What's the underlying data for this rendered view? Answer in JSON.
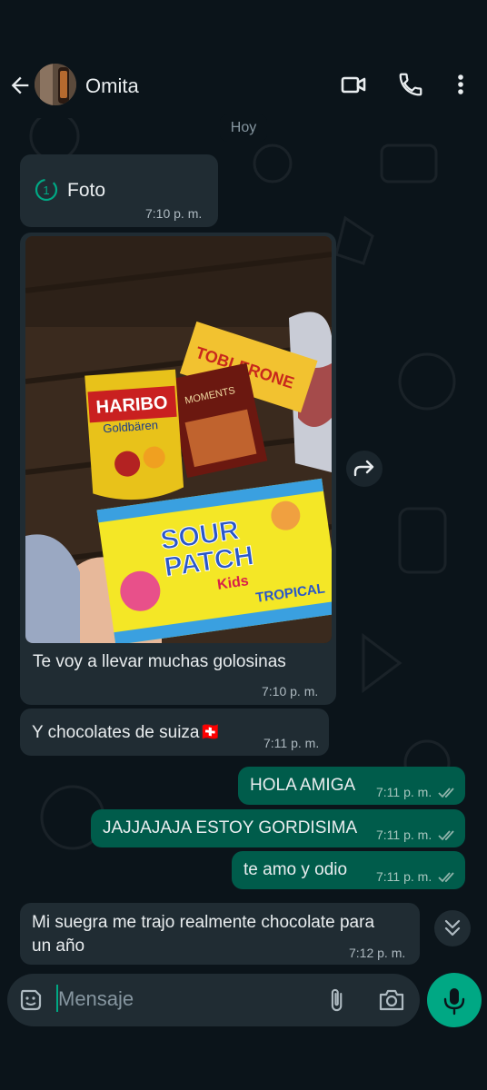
{
  "header": {
    "contact_name": "Omita"
  },
  "date_chip": "Hoy",
  "messages": [
    {
      "type": "incoming",
      "kind": "view-once",
      "text": "Foto",
      "time": "7:10 p. m."
    },
    {
      "type": "incoming",
      "kind": "image",
      "caption": "Te voy a llevar muchas golosinas",
      "time": "7:10 p. m."
    },
    {
      "type": "incoming",
      "text": "Y chocolates de suiza🇨🇭",
      "time": "7:11 p. m."
    },
    {
      "type": "outgoing",
      "text": "HOLA AMIGA",
      "time": "7:11 p. m."
    },
    {
      "type": "outgoing",
      "text": "JAJJAJAJA ESTOY GORDISIMA",
      "time": "7:11 p. m."
    },
    {
      "type": "outgoing",
      "text": "te amo y odio",
      "time": "7:11 p. m."
    },
    {
      "type": "incoming",
      "text": "Mi suegra me trajo realmente chocolate para un año",
      "time": "7:12 p. m."
    }
  ],
  "photo_labels": {
    "haribo": "HARIBO",
    "haribo_sub": "Goldbären",
    "toblerone": "TOBLERONE",
    "moments": "MOMENTS",
    "sourpatch_1": "SOUR",
    "sourpatch_2": "PATCH",
    "kids": "Kids",
    "tropical": "TROPICAL"
  },
  "composer": {
    "placeholder": "Mensaje"
  },
  "colors": {
    "background": "#0b141a",
    "incoming_bubble": "#202c33",
    "outgoing_bubble": "#005c4b",
    "accent": "#00a884"
  }
}
